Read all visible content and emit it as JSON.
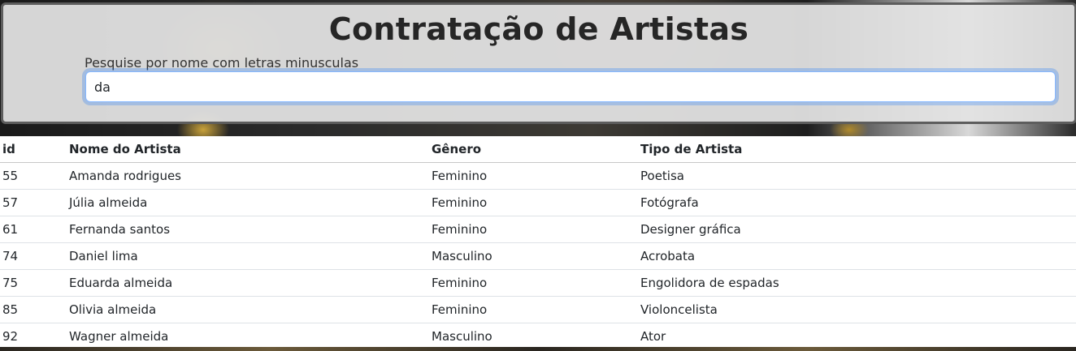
{
  "header": {
    "title": "Contratação de Artistas",
    "search_label": "Pesquise por nome com letras minusculas",
    "search_value": "da"
  },
  "table": {
    "columns": [
      "id",
      "Nome do Artista",
      "Gênero",
      "Tipo de Artista"
    ],
    "rows": [
      [
        "55",
        "Amanda rodrigues",
        "Feminino",
        "Poetisa"
      ],
      [
        "57",
        "Júlia almeida",
        "Feminino",
        "Fotógrafa"
      ],
      [
        "61",
        "Fernanda santos",
        "Feminino",
        "Designer gráfica"
      ],
      [
        "74",
        "Daniel lima",
        "Masculino",
        "Acrobata"
      ],
      [
        "75",
        "Eduarda almeida",
        "Feminino",
        "Engolidora de espadas"
      ],
      [
        "85",
        "Olivia almeida",
        "Feminino",
        "Violoncelista"
      ],
      [
        "92",
        "Wagner almeida",
        "Masculino",
        "Ator"
      ]
    ]
  },
  "colors": {
    "focus_ring": "#86b7fe",
    "panel_border": "#5d5d5d"
  }
}
